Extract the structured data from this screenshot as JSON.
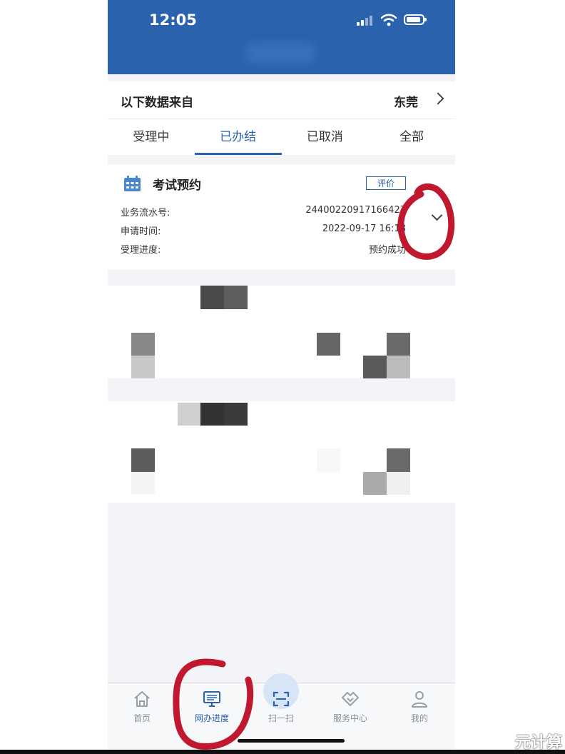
{
  "status_bar": {
    "time": "12:05"
  },
  "source": {
    "label": "以下数据来自",
    "city": "东莞"
  },
  "tabs": [
    {
      "label": "受理中"
    },
    {
      "label": "已办结"
    },
    {
      "label": "已取消"
    },
    {
      "label": "全部"
    }
  ],
  "active_tab": "已办结",
  "card": {
    "title": "考试预约",
    "rate_label": "评价",
    "rows": [
      {
        "label": "业务流水号:",
        "value": "24400220917166427"
      },
      {
        "label": "申请时间:",
        "value": "2022-09-17 16:18"
      },
      {
        "label": "受理进度:",
        "value": "预约成功"
      }
    ]
  },
  "bottom_nav": [
    {
      "label": "首页",
      "icon": "home-icon"
    },
    {
      "label": "网办进度",
      "icon": "monitor-icon"
    },
    {
      "label": "扫一扫",
      "icon": "scan-icon"
    },
    {
      "label": "服务中心",
      "icon": "handshake-icon"
    },
    {
      "label": "我的",
      "icon": "user-icon"
    }
  ],
  "active_nav": "网办进度",
  "watermark": "元计算",
  "colors": {
    "primary": "#2b62ad",
    "annotation": "#c0182f",
    "background": "#f3f4f7"
  }
}
